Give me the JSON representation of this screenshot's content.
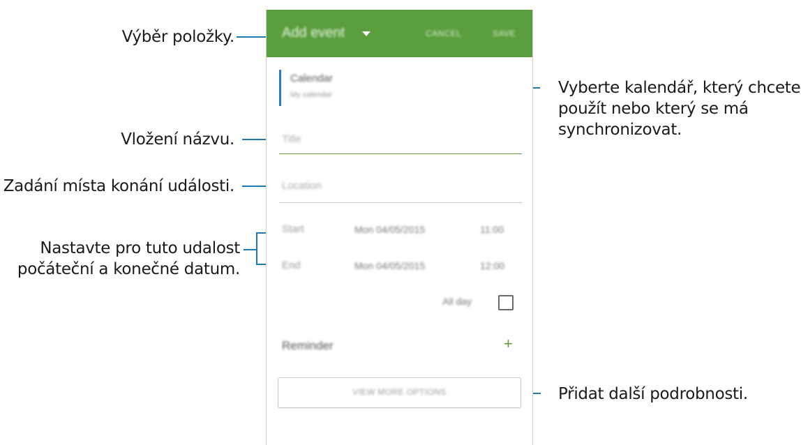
{
  "annotations": {
    "select_item": "Výběr položky.",
    "choose_calendar": [
      "Vyberte kalendář, který chcete",
      "použít nebo který se má",
      "synchronizovat."
    ],
    "enter_title": "Vložení názvu.",
    "enter_location": "Zadání místa konání události.",
    "set_dates": [
      "Nastavte pro tuto udalost",
      "počáteční a konečné datum."
    ],
    "add_details": "Přidat další podrobnosti."
  },
  "appbar": {
    "title": "Add event",
    "cancel": "CANCEL",
    "save": "SAVE",
    "color": "#5a9e3e"
  },
  "calendar": {
    "label": "Calendar",
    "value": "My calendar",
    "accent_color": "#2b7bc0"
  },
  "fields": {
    "title_placeholder": "Title",
    "location_placeholder": "Location"
  },
  "schedule": {
    "start_label": "Start",
    "start_date": "Mon 04/05/2015",
    "start_time": "11:00",
    "end_label": "End",
    "end_date": "Mon 04/05/2015",
    "end_time": "12:00",
    "all_day_label": "All day",
    "all_day_checked": false
  },
  "reminder": {
    "label": "Reminder",
    "add_icon": "plus-icon"
  },
  "more_options": {
    "label": "VIEW MORE OPTIONS"
  },
  "leader_color": "#1e7ab0"
}
